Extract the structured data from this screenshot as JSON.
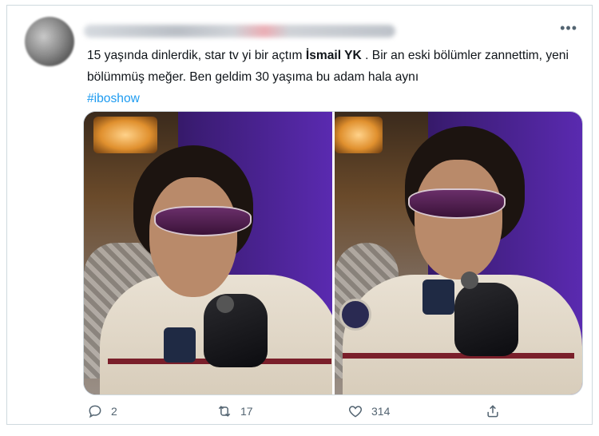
{
  "tweet": {
    "text_before_mention": "15 yaşında dinlerdik, star tv yi bir açtım ",
    "mention": "İsmail YK",
    "text_after_mention": " . Bir an eski bölümler zannettim, yeni bölümmüş meğer. Ben geldim 30 yaşıma bu adam hala aynı",
    "hashtag": "#iboshow",
    "more_icon": "more-horizontal-icon"
  },
  "actions": {
    "reply_count": "2",
    "retweet_count": "17",
    "like_count": "314"
  },
  "colors": {
    "link": "#1d9bf0",
    "text": "#0f1419",
    "muted": "#536471",
    "border": "#cfd9de"
  }
}
